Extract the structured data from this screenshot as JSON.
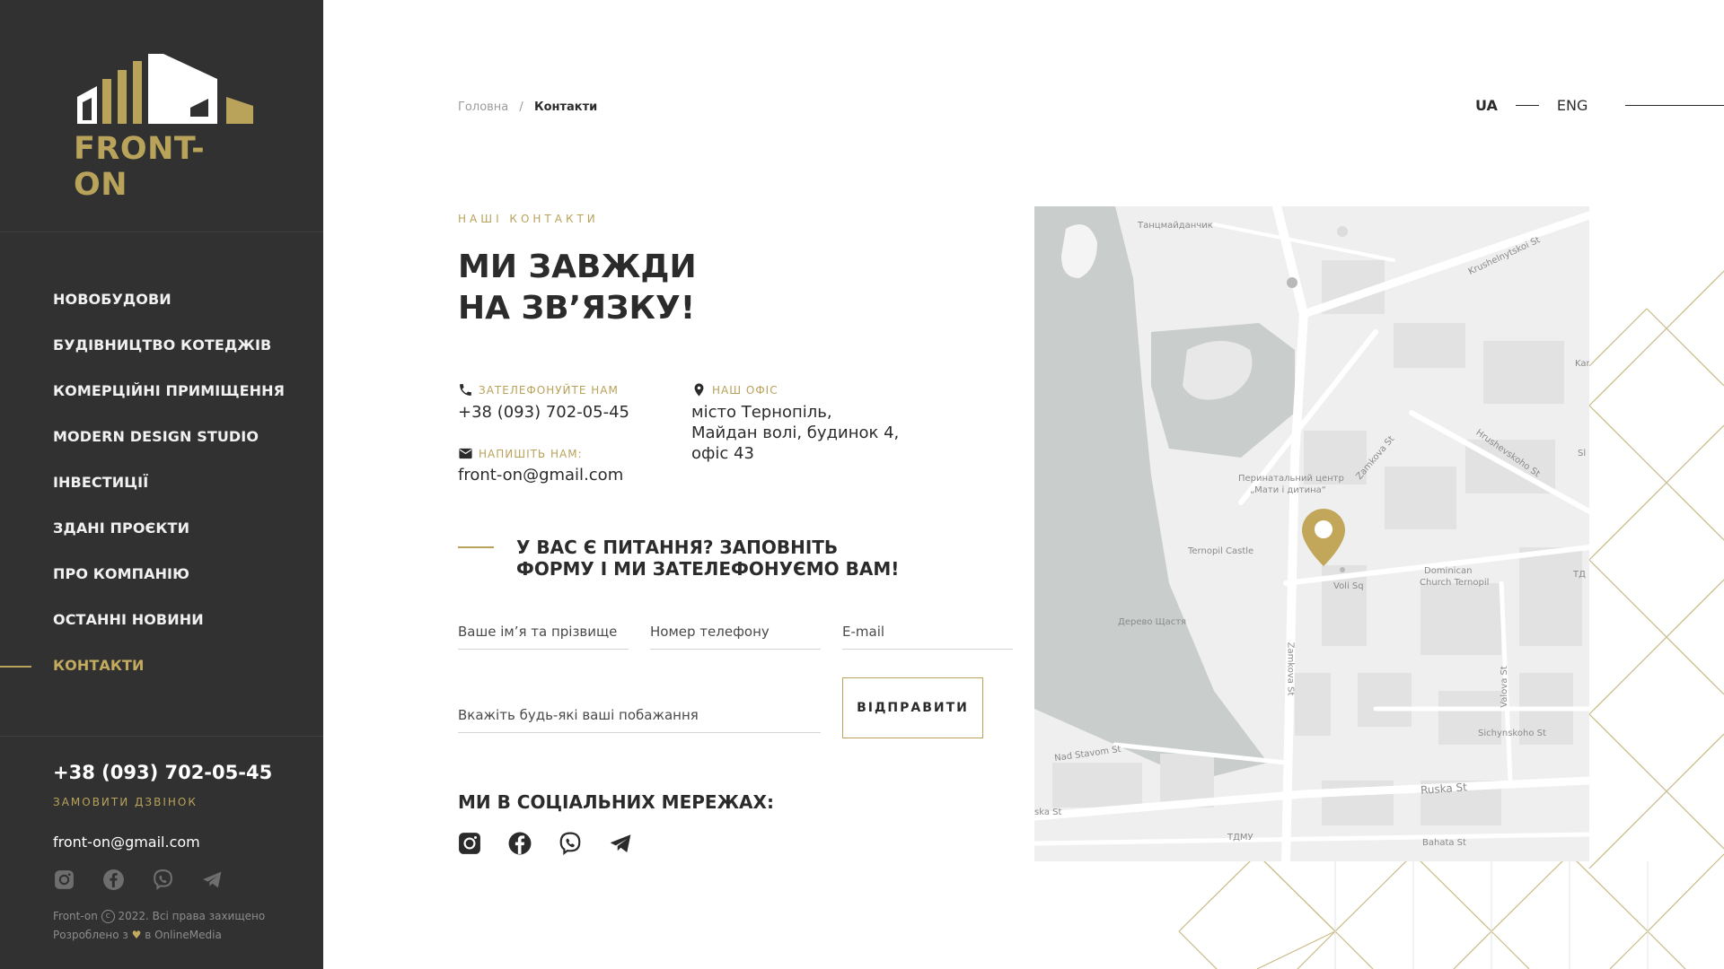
{
  "brand": {
    "logo_text": "FRONT-ON",
    "accent_color": "#b9a25a",
    "sidebar_color": "#313131"
  },
  "sidebar": {
    "nav": [
      {
        "label": "НОВОБУДОВИ"
      },
      {
        "label": "БУДІВНИЦТВО КОТЕДЖІВ"
      },
      {
        "label": "КОМЕРЦІЙНІ ПРИМІЩЕННЯ"
      },
      {
        "label": "MODERN DESIGN STUDIO"
      },
      {
        "label": "ІНВЕСТИЦІЇ"
      },
      {
        "label": "ЗДАНІ ПРОЄКТИ"
      },
      {
        "label": "ПРО КОМПАНІЮ"
      },
      {
        "label": "ОСТАННІ НОВИНИ"
      },
      {
        "label": "КОНТАКТИ",
        "active": true
      }
    ],
    "phone": "+38 (093) 702-05-45",
    "call_label": "ЗАМОВИТИ ДЗВІНОК",
    "email": "front-on@gmail.com",
    "social_icons": [
      "instagram-icon",
      "facebook-icon",
      "viber-icon",
      "telegram-icon"
    ],
    "copyright_brand": "Front-on",
    "copyright_text": "2022. Всі права захищено",
    "dev_prefix": "Розроблено з",
    "dev_suffix": "в OnlineMedia"
  },
  "header": {
    "breadcrumb_home": "Головна",
    "breadcrumb_sep": "/",
    "breadcrumb_current": "Контакти",
    "lang_active": "UA",
    "lang_other": "ENG"
  },
  "contacts": {
    "section_label": "НАШІ КОНТАКТИ",
    "title_line1": "МИ ЗАВЖДИ",
    "title_line2": "НА ЗВ’ЯЗКУ!",
    "call_label": "ЗАТЕЛЕФОНУЙТЕ НАМ",
    "phone": "+38 (093) 702-05-45",
    "write_label": "НАПИШІТЬ НАМ:",
    "email": "front-on@gmail.com",
    "office_label": "НАШ ОФІС",
    "office_line1": "місто Тернопіль,",
    "office_line2": "Майдан волі, будинок 4,",
    "office_line3": "офіс 43"
  },
  "form": {
    "question_line1": "У ВАС Є ПИТАННЯ? ЗАПОВНІТЬ",
    "question_line2": "ФОРМУ І МИ ЗАТЕЛЕФОНУЄМО ВАМ!",
    "name_placeholder": "Ваше ім’я та прізвище",
    "phone_placeholder": "Номер телефону",
    "email_placeholder": "E-mail",
    "message_placeholder": "Вкажіть будь-які ваші побажання",
    "submit_label": "ВІДПРАВИТИ"
  },
  "social": {
    "title": "МИ В СОЦІАЛЬНИХ МЕРЕЖАХ:",
    "icons": [
      "instagram-icon",
      "facebook-icon",
      "viber-icon",
      "telegram-icon"
    ]
  },
  "map": {
    "labels": [
      "Танцмайданчик",
      "Krushelnytskoi St",
      "Перинатальний центр",
      "„Мати і дитина“",
      "Zamkova St",
      "Hrushevskoho St",
      "Ternopil Castle",
      "Voli Sq",
      "Dominican",
      "Church Ternopil",
      "Дерево Щастя",
      "Zamkova St",
      "Valova St",
      "Sichynskoho St",
      "Nad Stavom St",
      "Ruska St",
      "ska St",
      "ТДМУ",
      "Bahata St",
      "Kan",
      "Sl",
      "ТД"
    ],
    "pin_color": "#c2a75a"
  }
}
